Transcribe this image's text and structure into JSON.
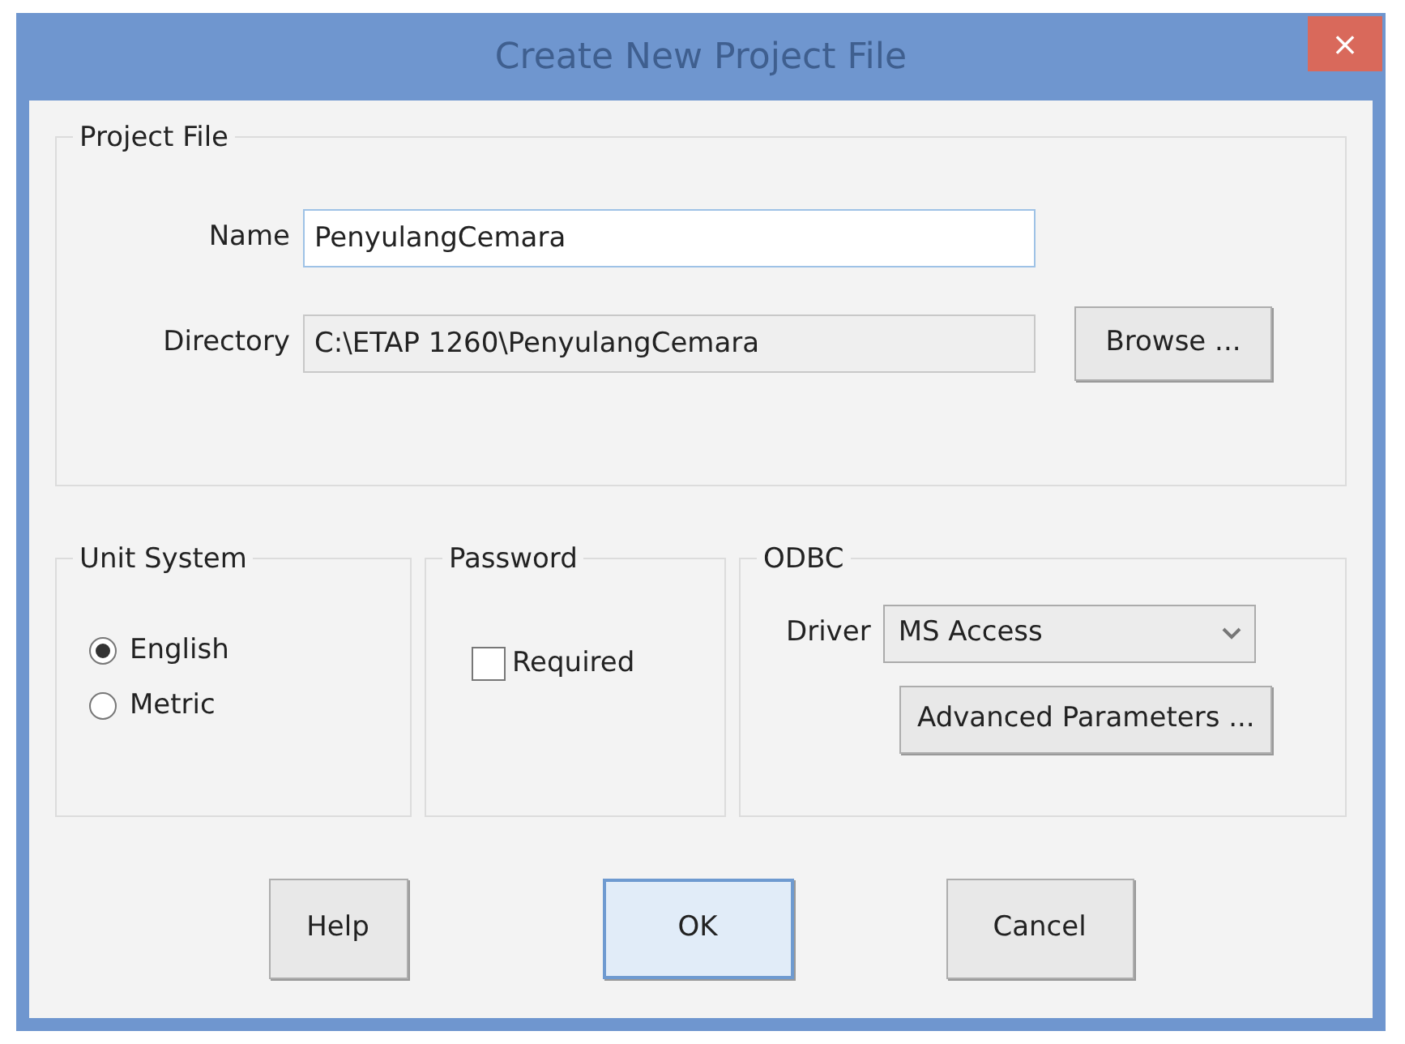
{
  "window": {
    "title": "Create New Project File",
    "close": "×"
  },
  "project_file": {
    "legend": "Project File",
    "name_label": "Name",
    "name_value": "PenyulangCemara",
    "directory_label": "Directory",
    "directory_value": "C:\\ETAP 1260\\PenyulangCemara",
    "browse": "Browse ..."
  },
  "unit_system": {
    "legend": "Unit System",
    "options": [
      {
        "label": "English",
        "selected": true
      },
      {
        "label": "Metric",
        "selected": false
      }
    ]
  },
  "password": {
    "legend": "Password",
    "required": {
      "label": "Required",
      "checked": false
    }
  },
  "odbc": {
    "legend": "ODBC",
    "driver_label": "Driver",
    "driver_value": "MS Access",
    "advanced": "Advanced Parameters ..."
  },
  "buttons": [
    {
      "label": "Help",
      "default": false
    },
    {
      "label": "OK",
      "default": true
    },
    {
      "label": "Cancel",
      "default": false
    }
  ]
}
